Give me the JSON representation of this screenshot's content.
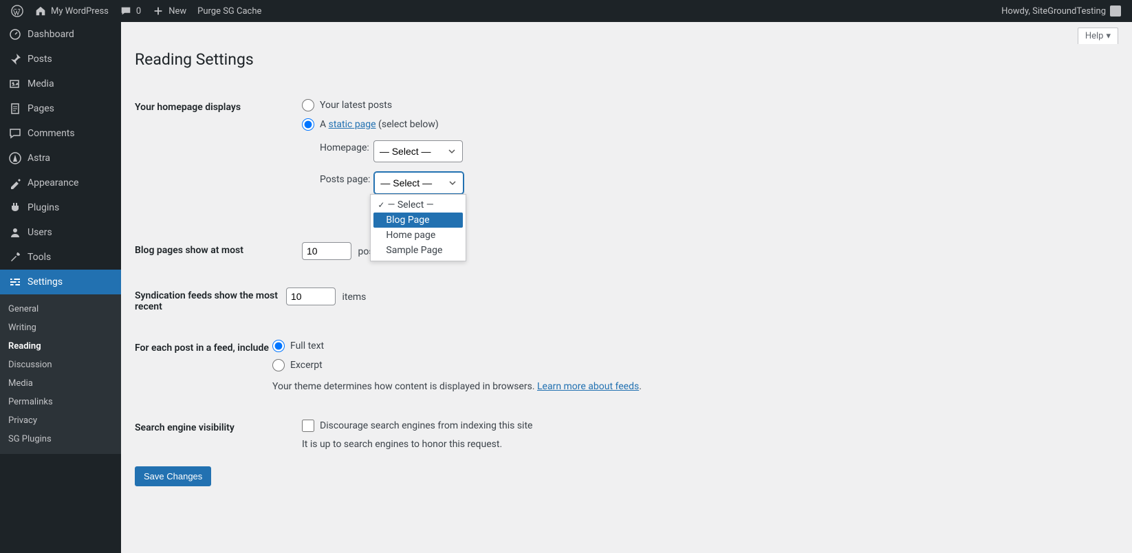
{
  "topbar": {
    "site_name": "My WordPress",
    "comments_count": "0",
    "new_label": "New",
    "purge_label": "Purge SG Cache",
    "howdy": "Howdy, SiteGroundTesting"
  },
  "sidebar": {
    "items": [
      {
        "label": "Dashboard"
      },
      {
        "label": "Posts"
      },
      {
        "label": "Media"
      },
      {
        "label": "Pages"
      },
      {
        "label": "Comments"
      },
      {
        "label": "Astra"
      },
      {
        "label": "Appearance"
      },
      {
        "label": "Plugins"
      },
      {
        "label": "Users"
      },
      {
        "label": "Tools"
      },
      {
        "label": "Settings"
      }
    ],
    "submenu": [
      {
        "label": "General"
      },
      {
        "label": "Writing"
      },
      {
        "label": "Reading"
      },
      {
        "label": "Discussion"
      },
      {
        "label": "Media"
      },
      {
        "label": "Permalinks"
      },
      {
        "label": "Privacy"
      },
      {
        "label": "SG Plugins"
      }
    ]
  },
  "help_label": "Help",
  "page_title": "Reading Settings",
  "form": {
    "homepage_displays_label": "Your homepage displays",
    "latest_posts_label": "Your latest posts",
    "static_prefix": "A ",
    "static_link": "static page",
    "static_suffix": " (select below)",
    "homepage_label": "Homepage:",
    "homepage_selected": "— Select —",
    "posts_page_label": "Posts page:",
    "dropdown_options": [
      {
        "label": "— Select —",
        "checked": true
      },
      {
        "label": "Blog Page",
        "highlighted": true
      },
      {
        "label": "Home page"
      },
      {
        "label": "Sample Page"
      }
    ],
    "blog_pages_label": "Blog pages show at most",
    "blog_pages_value": "10",
    "posts_suffix": "posts",
    "syndication_label": "Syndication feeds show the most recent",
    "syndication_value": "10",
    "items_suffix": "items",
    "feed_include_label": "For each post in a feed, include",
    "full_text_label": "Full text",
    "excerpt_label": "Excerpt",
    "theme_desc_prefix": "Your theme determines how content is displayed in browsers. ",
    "theme_desc_link": "Learn more about feeds",
    "theme_desc_suffix": ".",
    "search_visibility_label": "Search engine visibility",
    "discourage_label": "Discourage search engines from indexing this site",
    "discourage_desc": "It is up to search engines to honor this request.",
    "save_label": "Save Changes"
  }
}
